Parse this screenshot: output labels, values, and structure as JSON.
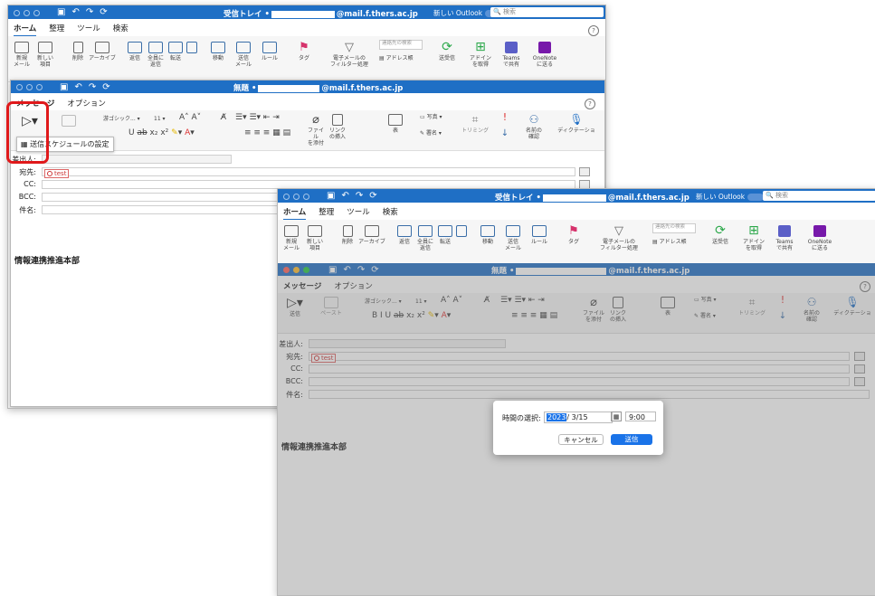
{
  "window_main": {
    "title_prefix": "受信トレイ •",
    "title_domain": "@mail.f.thers.ac.jp",
    "new_outlook_label": "新しい Outlook",
    "search_placeholder": "検索",
    "tabs": [
      "ホーム",
      "整理",
      "ツール",
      "検索"
    ],
    "ribbon": {
      "new_mail": "新規\nメール",
      "new_item": "新しい\n項目",
      "delete": "削除",
      "archive": "アーカイブ",
      "reply": "返信",
      "reply_all": "全員に\n返信",
      "forward": "転送",
      "move": "移動",
      "send_mail": "送信\nメール",
      "rules": "ルール",
      "tag": "タグ",
      "filter": "電子メールの\nフィルター処理",
      "address_book": "アドレス帳",
      "search_people": "連絡先の検索",
      "send_receive": "送受信",
      "get_addins": "アドイン\nを取得",
      "teams": "Teams\nで共有",
      "onenote": "OneNote\nに送る"
    }
  },
  "compose": {
    "title_prefix": "無題 •",
    "title_domain": "@mail.f.thers.ac.jp",
    "tabs": [
      "メッセージ",
      "オプション"
    ],
    "font_name": "游ゴシック...",
    "font_size": "11",
    "ribbon": {
      "send": "送信",
      "paste": "ペースト",
      "attach_file": "ファイル\nを添付",
      "insert_link": "リンク\nの挿入",
      "table": "表",
      "picture": "写真",
      "signature": "署名",
      "trimming": "トリミング",
      "check_names": "名前の\n確認",
      "dictation": "ディクテーショ"
    },
    "dropdown_schedule": "送信スケジュールの設定",
    "from_label": "差出人:",
    "to_label": "宛先:",
    "cc_label": "CC:",
    "bcc_label": "BCC:",
    "subject_label": "件名:",
    "recipient": "test",
    "body_text": "情報連携推進本部"
  },
  "dialog": {
    "label": "時間の選択:",
    "year": "2023",
    "date": "3/15",
    "time": "9:00",
    "cancel": "キャンセル",
    "send": "送信"
  },
  "colors": {
    "titlebar": "#1f6fc5",
    "highlight_box": "#e0191b",
    "primary_button": "#1a73e8"
  }
}
